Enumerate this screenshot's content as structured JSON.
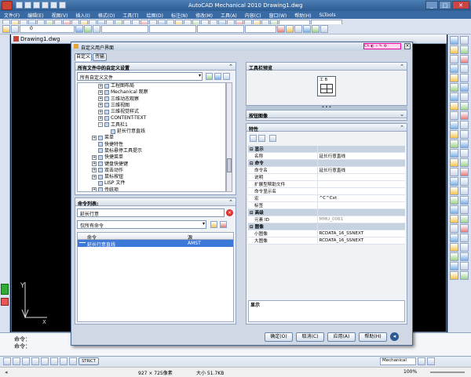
{
  "app": {
    "window_title": "AutoCAD Mechanical 2010    Drawing1.dwg",
    "menu": [
      "文件(F)",
      "编辑(E)",
      "视图(V)",
      "插入(I)",
      "格式(O)",
      "工具(T)",
      "绘图(D)",
      "标注(N)",
      "修改(M)",
      "工具(A)",
      "内容(C)",
      "窗口(W)",
      "帮助(H)",
      "SLTools"
    ],
    "doc_tab": "Drawing1.dwg",
    "layer_combo": "0",
    "cmd_lines": [
      "命令：",
      "命令："
    ],
    "status": {
      "coords": "927 × 725像素",
      "size": "大小 51.7KB",
      "workspace": "Mechanical",
      "zoom": "100%",
      "strict": "STRICT"
    },
    "ucs": {
      "y": "Y",
      "x": "X"
    }
  },
  "dialog": {
    "title": "自定义用户界面",
    "tabs": [
      "自定义",
      "传输"
    ],
    "left_top": {
      "header": "所有文件中的自定义设置",
      "combo": "所有自定义文件",
      "tree": [
        {
          "label": "工程图布局",
          "indent": 1,
          "pm": "+"
        },
        {
          "label": "Mechanical 观察",
          "indent": 1,
          "pm": "+"
        },
        {
          "label": "三维动态观察",
          "indent": 1,
          "pm": "+"
        },
        {
          "label": "三维视图",
          "indent": 1,
          "pm": "+"
        },
        {
          "label": "三维视觉样式",
          "indent": 1,
          "pm": "+"
        },
        {
          "label": "CONTENT-TEXT",
          "indent": 1,
          "pm": "+"
        },
        {
          "label": "工具栏1",
          "indent": 1,
          "pm": "-"
        },
        {
          "label": "延长行意直线",
          "indent": 2,
          "pm": ""
        },
        {
          "label": "菜单",
          "indent": 0,
          "pm": "+"
        },
        {
          "label": "快捷特性",
          "indent": 0,
          "pm": ""
        },
        {
          "label": "鼠标悬停工具提示",
          "indent": 0,
          "pm": ""
        },
        {
          "label": "快捷菜单",
          "indent": 0,
          "pm": "+"
        },
        {
          "label": "键盘快捷键",
          "indent": 0,
          "pm": "+"
        },
        {
          "label": "双击动作",
          "indent": 0,
          "pm": "+"
        },
        {
          "label": "鼠标按钮",
          "indent": 0,
          "pm": "+"
        },
        {
          "label": "LISP 文件",
          "indent": 0,
          "pm": ""
        },
        {
          "label": "传统项",
          "indent": 0,
          "pm": "+"
        },
        {
          "label": "局部自定义文件",
          "indent": 0,
          "pm": "+"
        }
      ]
    },
    "left_bottom": {
      "header": "命令列表:",
      "search": "延长行意",
      "filter": "仅所有命令",
      "col_cmd": "命令",
      "col_src": "源",
      "rows": [
        {
          "cmd": "延长行意直线",
          "src": "AMST"
        }
      ]
    },
    "preview": {
      "header": "工具栏预览",
      "btn_label": "工 B"
    },
    "images": {
      "header": "按钮图像"
    },
    "props": {
      "header": "特性",
      "rows": [
        {
          "cat": true,
          "name": "显示",
          "val": ""
        },
        {
          "cat": false,
          "name": "名称",
          "val": "延长行意直线"
        },
        {
          "cat": true,
          "name": "命令",
          "val": ""
        },
        {
          "cat": false,
          "name": "命令名",
          "val": "延长行意直线"
        },
        {
          "cat": false,
          "name": "说明",
          "val": ""
        },
        {
          "cat": false,
          "name": "扩展型帮助文件",
          "val": ""
        },
        {
          "cat": false,
          "name": "命令显示名",
          "val": ""
        },
        {
          "cat": false,
          "name": "宏",
          "val": "^C^Cxt"
        },
        {
          "cat": false,
          "name": "标签",
          "val": ""
        },
        {
          "cat": true,
          "name": "高级",
          "val": ""
        },
        {
          "cat": false,
          "name": "元素 ID",
          "val": "MMU_0061"
        },
        {
          "cat": true,
          "name": "图像",
          "val": ""
        },
        {
          "cat": false,
          "name": "小图像",
          "val": "RCDATA_16_SSNEXT"
        },
        {
          "cat": false,
          "name": "大图像",
          "val": "RCDATA_16_SSNEXT"
        }
      ],
      "desc_label": "显示"
    },
    "buttons": {
      "ok": "确定(O)",
      "cancel": "取消(C)",
      "apply": "应用(A)",
      "help": "帮助(H)"
    }
  },
  "colors": {
    "title": "#2d5c91",
    "bg": "#000000",
    "dialog": "#cfd8e4"
  }
}
